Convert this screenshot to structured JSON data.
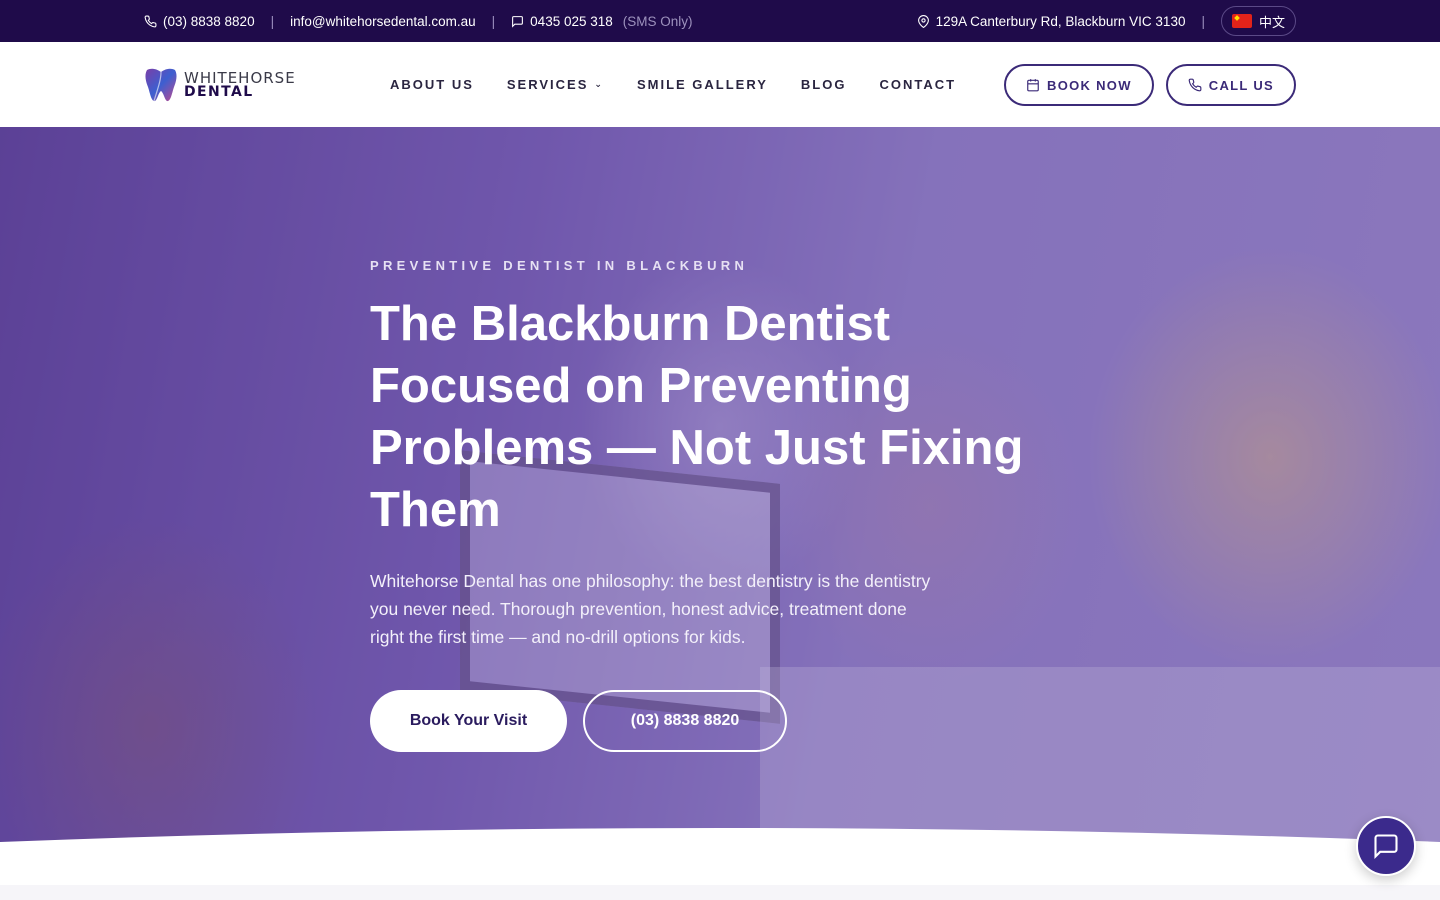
{
  "topbar": {
    "phone": "(03) 8838 8820",
    "email": "info@whitehorsedental.com.au",
    "sms_number": "0435 025 318",
    "sms_note": "(SMS Only)",
    "address": "129A Canterbury Rd, Blackburn VIC 3130",
    "language_label": "中文"
  },
  "header": {
    "logo_line1": "WHITEHORSE",
    "logo_line2": "DENTAL",
    "nav": [
      {
        "label": "ABOUT US"
      },
      {
        "label": "SERVICES"
      },
      {
        "label": "SMILE GALLERY"
      },
      {
        "label": "BLOG"
      },
      {
        "label": "CONTACT"
      }
    ],
    "book_label": "BOOK NOW",
    "call_label": "CALL US"
  },
  "hero": {
    "eyebrow": "PREVENTIVE DENTIST IN BLACKBURN",
    "title": "The Blackburn Dentist Focused on Preventing Problems — Not Just Fixing Them",
    "subtitle": "Whitehorse Dental has one philosophy: the best dentistry is the dentistry you never need. Thorough prevention, honest advice, treatment done right the first time — and no-drill options for kids.",
    "primary_cta": "Book Your Visit",
    "secondary_cta": "(03) 8838 8820"
  },
  "icons": {
    "phone": "phone-icon",
    "chat": "chat-icon",
    "pin": "map-pin-icon",
    "calendar": "calendar-icon"
  },
  "colors": {
    "topbar_bg": "#1f0b4a",
    "brand_purple": "#3b2a78",
    "chat_button": "#3b2a8c",
    "hero_overlay": "#7a62b3"
  }
}
